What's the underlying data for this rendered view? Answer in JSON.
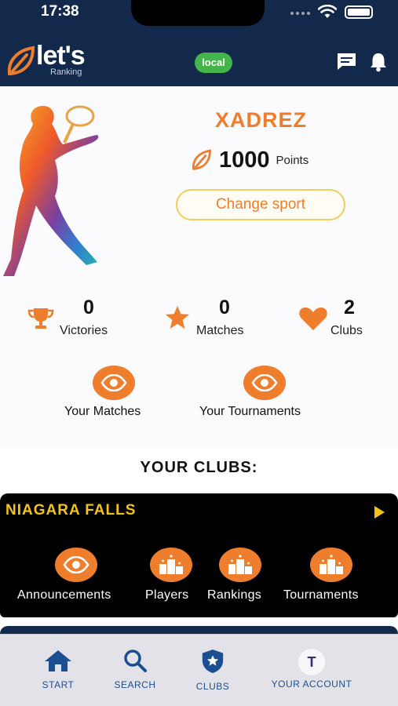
{
  "status_bar": {
    "time": "17:38"
  },
  "header": {
    "logo_text": "let's",
    "logo_sub": "Ranking",
    "environment_badge": "local",
    "icons": [
      "chat-icon",
      "bell-icon"
    ]
  },
  "profile": {
    "sport": "XADREZ",
    "points_value": "1000",
    "points_label": "Points",
    "change_sport_label": "Change sport"
  },
  "stats": [
    {
      "value": "0",
      "label": "Victories",
      "icon": "trophy-icon"
    },
    {
      "value": "0",
      "label": "Matches",
      "icon": "star-icon"
    },
    {
      "value": "2",
      "label": "Clubs",
      "icon": "heart-icon"
    }
  ],
  "quick_links": [
    {
      "label": "Your Matches"
    },
    {
      "label": "Your Tournaments"
    }
  ],
  "clubs_section": {
    "title": "YOUR CLUBS:",
    "club": {
      "name": "NIAGARA FALLS",
      "actions": [
        {
          "label": "Announcements",
          "icon": "eye-icon"
        },
        {
          "label": "Players",
          "icon": "podium-icon"
        },
        {
          "label": "Rankings",
          "icon": "podium-icon"
        },
        {
          "label": "Tournaments",
          "icon": "podium-icon"
        }
      ]
    }
  },
  "tab_bar": {
    "items": [
      {
        "label": "START",
        "icon": "home-icon"
      },
      {
        "label": "SEARCH",
        "icon": "search-icon"
      },
      {
        "label": "CLUBS",
        "icon": "shield-star-icon"
      },
      {
        "label": "YOUR ACCOUNT",
        "icon": "avatar"
      }
    ],
    "avatar_initial": "T"
  },
  "colors": {
    "header_bg": "#13294b",
    "accent_orange": "#ee7d2c",
    "club_gold": "#f4c31b",
    "badge_green": "#43b54a",
    "tab_blue": "#1c4f91"
  }
}
